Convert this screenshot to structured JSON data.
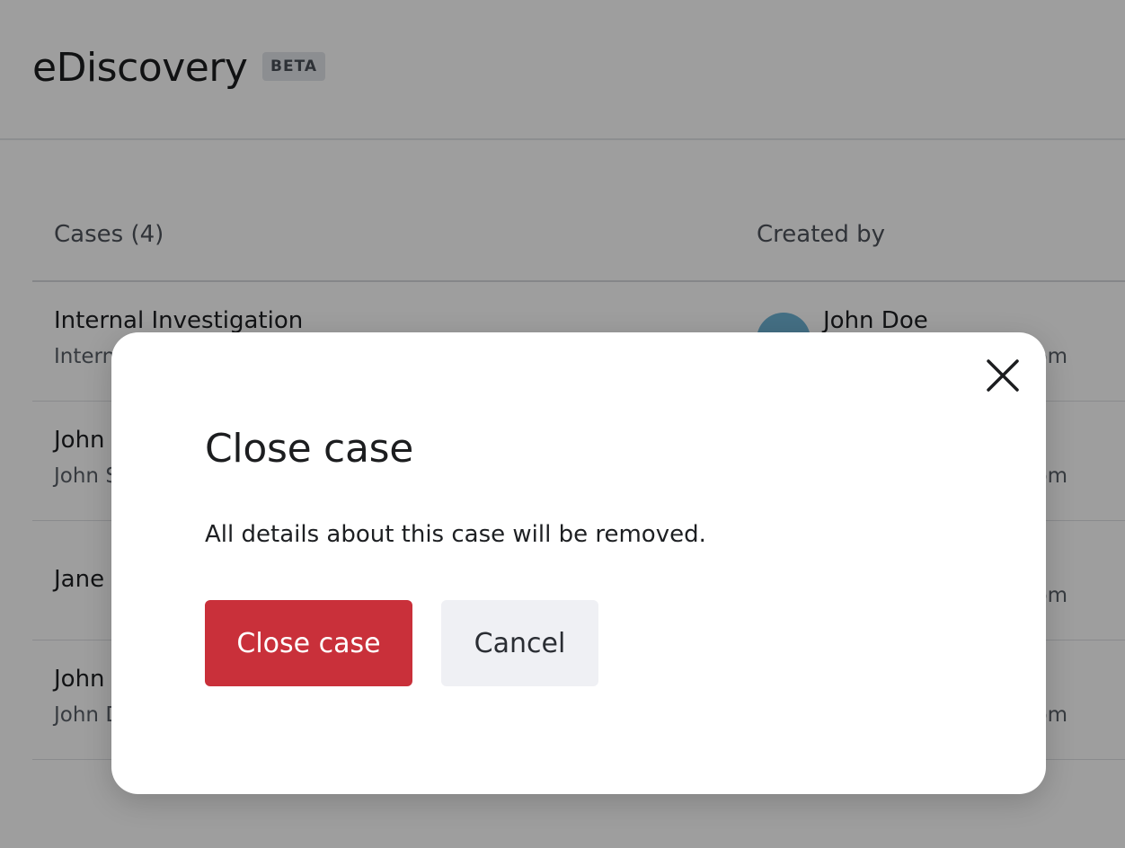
{
  "header": {
    "title": "eDiscovery",
    "badge": "BETA"
  },
  "table": {
    "columns": {
      "cases": "Cases (4)",
      "created_by": "Created by"
    },
    "rows": [
      {
        "title": "Internal Investigation",
        "subtitle": "Intern",
        "creator_name": "John Doe",
        "creator_email": "om"
      },
      {
        "title": "John",
        "subtitle": "John S",
        "creator_name": "",
        "creator_email": "om"
      },
      {
        "title": "Jane",
        "subtitle": "",
        "creator_name": "",
        "creator_email": "om"
      },
      {
        "title": "John",
        "subtitle": "John D",
        "creator_name": "",
        "creator_email": "om"
      }
    ]
  },
  "modal": {
    "title": "Close case",
    "body": "All details about this case will be removed.",
    "confirm_label": "Close case",
    "cancel_label": "Cancel",
    "close_icon": "close-icon"
  },
  "colors": {
    "danger": "#c9303a",
    "secondary_bg": "#eff0f4",
    "avatar": "#6fb3d6"
  }
}
